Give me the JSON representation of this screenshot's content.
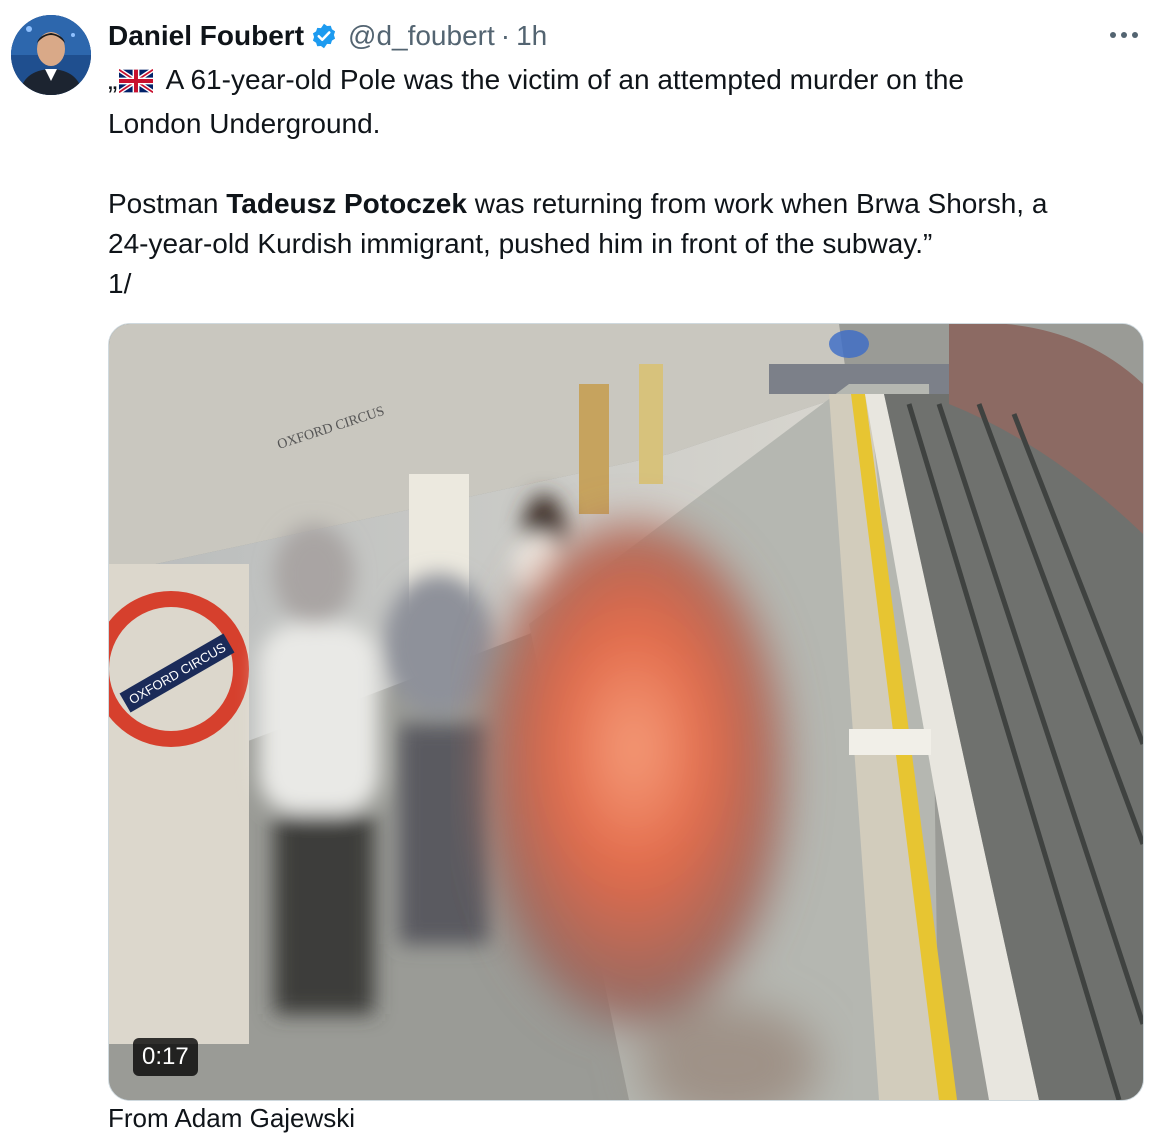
{
  "author": {
    "name": "Daniel Foubert",
    "handle": "@d_foubert",
    "separator": "·",
    "time": "1h"
  },
  "tweet": {
    "line1_prefix": "„",
    "line1_text": " A 61-year-old Pole was the victim of an attempted murder on the",
    "line2": "London Underground.",
    "para2_before": "Postman ",
    "para2_bold": "Tadeusz Potoczek",
    "para2_after": " was returning from work when Brwa Shorsh, a",
    "para2_line2": "24-year-old Kurdish immigrant, pushed him in front of the subway.”",
    "thread_marker": "1/"
  },
  "media": {
    "type": "video",
    "duration": "0:17",
    "signage_text": "OXFORD CIRCUS"
  },
  "next_preview": "From Adam Gajewski"
}
